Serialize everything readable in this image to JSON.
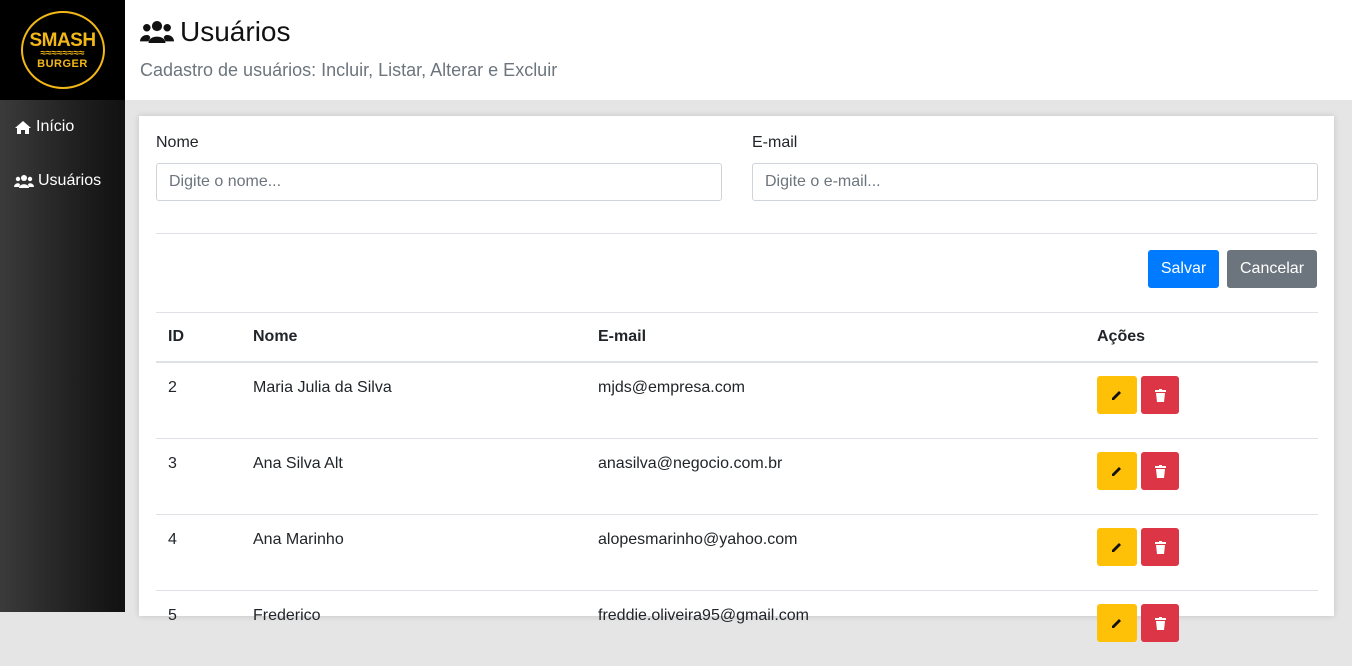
{
  "brand": {
    "line1": "SMASH",
    "line2": "BURGER"
  },
  "sidebar": {
    "items": [
      {
        "label": "Início",
        "icon": "home-icon"
      },
      {
        "label": "Usuários",
        "icon": "users-icon"
      }
    ]
  },
  "header": {
    "title": "Usuários",
    "subtitle": "Cadastro de usuários: Incluir, Listar, Alterar e Excluir"
  },
  "form": {
    "name_label": "Nome",
    "name_placeholder": "Digite o nome...",
    "email_label": "E-mail",
    "email_placeholder": "Digite o e-mail...",
    "save_label": "Salvar",
    "cancel_label": "Cancelar"
  },
  "table": {
    "columns": [
      "ID",
      "Nome",
      "E-mail",
      "Ações"
    ],
    "rows": [
      {
        "id": "2",
        "name": "Maria Julia da Silva",
        "email": "mjds@empresa.com"
      },
      {
        "id": "3",
        "name": "Ana Silva Alt",
        "email": "anasilva@negocio.com.br"
      },
      {
        "id": "4",
        "name": "Ana Marinho",
        "email": "alopesmarinho@yahoo.com"
      },
      {
        "id": "5",
        "name": "Frederico",
        "email": "freddie.oliveira95@gmail.com"
      }
    ]
  },
  "colors": {
    "primary": "#007bff",
    "secondary": "#6c757d",
    "warning": "#ffc107",
    "danger": "#dc3545",
    "brand": "#f3b818"
  }
}
